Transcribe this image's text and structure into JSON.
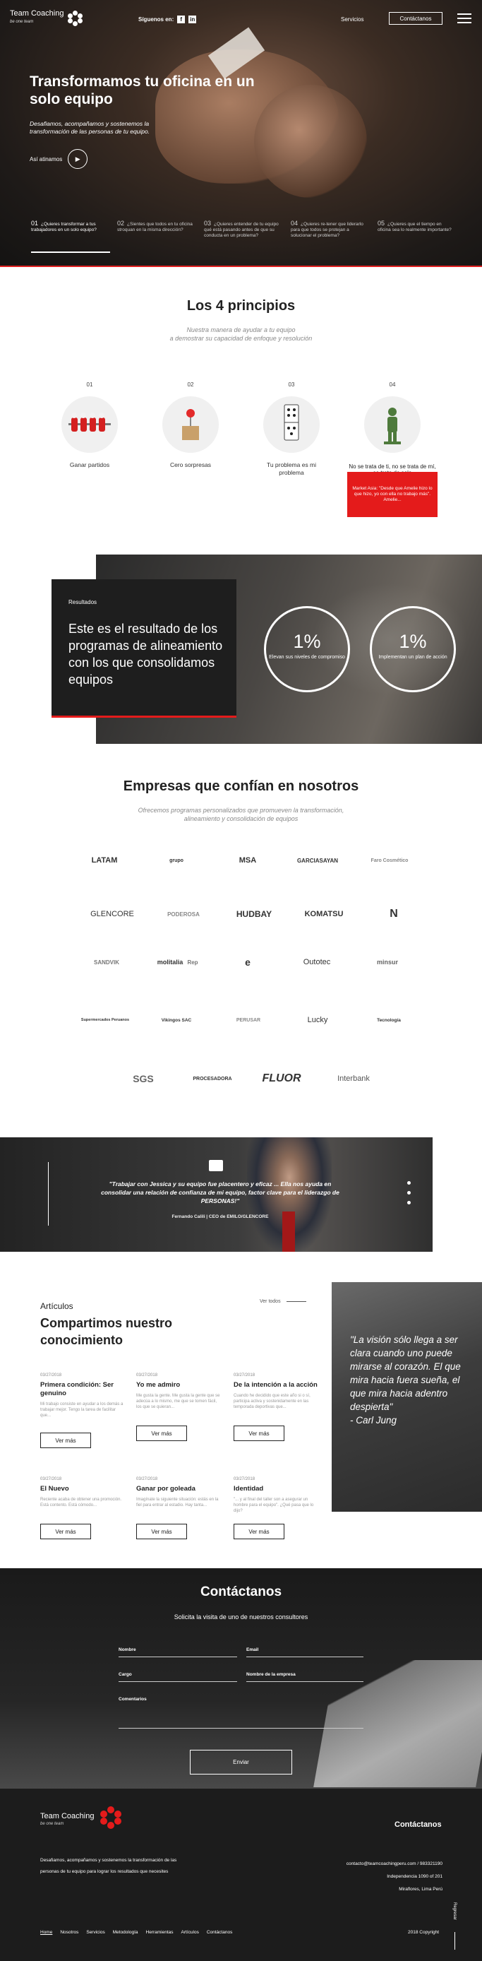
{
  "header": {
    "brand": "Team Coaching",
    "brand_tagline": "be one team",
    "follow_label": "Síguenos en:",
    "social": [
      "f",
      "in"
    ],
    "nav_services": "Servicios",
    "contact_button": "Contáctanos"
  },
  "hero": {
    "title": "Transformamos tu oficina en un solo equipo",
    "lead": "Desafiamos, acompañamos y sostenemos la transformación de las personas de tu equipo.",
    "play_label": "Así atinamos",
    "steps": [
      {
        "num": "01",
        "text": "¿Quieres transformar a tus trabajadores en un solo equipo?"
      },
      {
        "num": "02",
        "text": "¿Sientes que todos en tu oficina stroquan en la misma dirección?"
      },
      {
        "num": "03",
        "text": "¿Quieres entender de tu equipo qué está pasando antes de que su conducta en un problema?"
      },
      {
        "num": "04",
        "text": "¿Quieres re-tener que liderarlo para que todos se protejan a solucionar el problema?"
      },
      {
        "num": "05",
        "text": "¿Quieres que el tiempo en oficina sea lo realmente importante?"
      }
    ]
  },
  "principles": {
    "title": "Los 4 principios",
    "subtitle_1": "Nuestra manera de ayudar a tu equipo",
    "subtitle_2": "a demostrar su capacidad de enfoque y resolución",
    "items": [
      {
        "num": "01",
        "label": "Ganar partidos"
      },
      {
        "num": "02",
        "label": "Cero sorpresas"
      },
      {
        "num": "03",
        "label": "Tu problema es mi problema"
      },
      {
        "num": "04",
        "label": "No se trata de ti, no se trata de mí, se trata de solo"
      }
    ],
    "p4_quote": "Market Asia: \"Desde que Amelie hizo lo que hizo, yo con ella no trabajo más\". Amelie..."
  },
  "results": {
    "kicker": "Resultados",
    "heading": "Este es el resultado de los programas de alineamiento con los que consolidamos equipos",
    "stats": [
      {
        "value": "1%",
        "label": "Elevan sus niveles de compromiso"
      },
      {
        "value": "1%",
        "label": "Implementan un plan de acción"
      }
    ]
  },
  "companies": {
    "title": "Empresas que confían en nosotros",
    "subtitle_1": "Ofrecemos programas personalizados que promueven la transformación,",
    "subtitle_2": "alineamiento y consolidación de equipos",
    "logos": [
      "LATAM",
      "grupo",
      "MSA",
      "GARCIASAYAN",
      "Faro Cosmético",
      "GLENCORE",
      "PODEROSA",
      "HUDBAY",
      "KOMATSU",
      "N",
      "SANDVIK",
      "molitalia",
      "Rep",
      "e",
      "Outotec",
      "minsur",
      "Supermercados Peruanos",
      "Vikingos SAC",
      "PERUSAR",
      "Lucky",
      "Tecnología",
      "SGS",
      "PROCESADORA",
      "FLUOR",
      "Interbank"
    ]
  },
  "testimonial": {
    "quote": "\"Trabajar con Jessica y su equipo fue placentero y eficaz ... Ella nos ayuda en consolidar una relación de confianza de mi equipo, factor clave para el liderazgo de PERSONAS!\"",
    "author": "Fernando Calili | CEO de EMILO/GLENCORE"
  },
  "articles": {
    "kicker": "Artículos",
    "heading": "Compartimos nuestro conocimiento",
    "see_all": "Ver todos",
    "items": [
      {
        "date": "03/27/2018",
        "title": "Primera condición: Ser genuino",
        "excerpt": "Mi trabajo consiste en ayudar a los demás a trabajar mejor. Tengo la tarea de facilitar que...",
        "button": "Ver más"
      },
      {
        "date": "03/27/2018",
        "title": "Yo me admiro",
        "excerpt": "Me gusta la gente. Me gusta la gente que se adecúa a lo mismo, me que se tomen fácil, los que se quieran...",
        "button": "Ver más"
      },
      {
        "date": "03/27/2018",
        "title": "De la intención a la acción",
        "excerpt": "Cuando he decidido que este año si o sí, participa activa y sostenidamente en las temporada deportivas que...",
        "button": "Ver más"
      },
      {
        "date": "03/27/2018",
        "title": "El Nuevo",
        "excerpt": "Reciente acaba de obtener una promoción. Está contento. Está cómodo...",
        "button": "Ver más"
      },
      {
        "date": "03/27/2018",
        "title": "Ganar por goleada",
        "excerpt": "Imagínate la siguiente situación: estás en la fiel para entrar al estadio. Hay tanta...",
        "button": "Ver más"
      },
      {
        "date": "03/27/2018",
        "title": "Identidad",
        "excerpt": "\"... y al final del taller son a asegurar un hombre para el equipo\". ¿Qué pasa que lo dijo?",
        "button": "Ver más"
      }
    ],
    "jung_quote": "\"La visión sólo llega a ser clara cuando uno puede mirarse al corazón. El que mira hacia fuera sueña, el que mira hacia adentro despierta\"",
    "jung_author": "- Carl Jung"
  },
  "contact": {
    "title": "Contáctanos",
    "subtitle": "Solicita la visita de uno de nuestros consultores",
    "fields": {
      "name": "Nombre",
      "email": "Email",
      "role": "Cargo",
      "company": "Nombre de la empresa",
      "comments": "Comentarios"
    },
    "submit": "Enviar"
  },
  "footer": {
    "brand": "Team Coaching",
    "tagline": "be one team",
    "description": "Desafiamos, acompañamos y sostenemos la transformación de las personas de tu equipo para lograr los resultados que necesites",
    "contact_title": "Contáctanos",
    "email_phone": "contacto@teamcoachingperu.com / 983321190",
    "address_1": "Independencia 1090 of 201",
    "address_2": "Miraflores, Lima Perú",
    "nav": [
      "Home",
      "Nosotros",
      "Servicios",
      "Metodología",
      "Herramientas",
      "Artículos",
      "Contáctanos"
    ],
    "copyright": "2018 Copyright",
    "to_top": "Regresar"
  },
  "colors": {
    "accent": "#e41b1b",
    "dark": "#1c1c1c"
  }
}
